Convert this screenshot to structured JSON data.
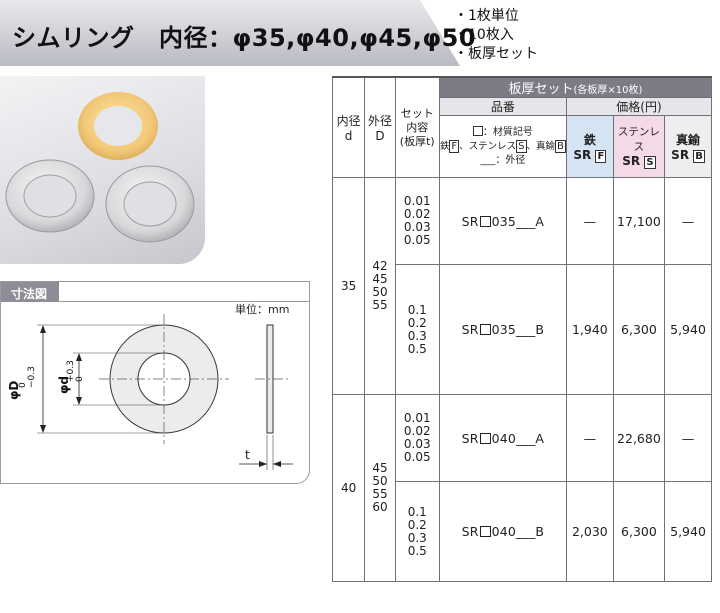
{
  "header": {
    "title": "シムリング　内径：φ35,φ40,φ45,φ50",
    "features": [
      "1枚単位",
      "10枚入",
      "板厚セット"
    ],
    "bullet": "・"
  },
  "dimension": {
    "tab_label": "寸法図",
    "unit_label": "単位：mm",
    "outer_label": "φD",
    "outer_tol_upper": "0",
    "outer_tol_lower": "−0.3",
    "inner_label": "φd",
    "inner_tol_upper": "+0.3",
    "inner_tol_lower": "0",
    "thickness_label": "t"
  },
  "table": {
    "headers": {
      "inner": "内径",
      "inner_sym": "d",
      "outer": "外径",
      "outer_sym": "D",
      "set": "セット",
      "set_contents": "内容",
      "set_thickness": "(板厚t)",
      "title": "板厚セット",
      "title_note": "(各板厚×10枚)",
      "part_number": "品番",
      "price": "価格(円)",
      "mat_key_1": "：材質記号",
      "mat_key_fe": "鉄",
      "mat_key_fe_code": "F",
      "mat_key_sus": "ステンレス",
      "mat_key_sus_code": "S",
      "mat_key_bs": "真鍮",
      "mat_key_bs_code": "B",
      "mat_key_2": "___：外径",
      "col_fe": "鉄",
      "col_sus": "ステンレス",
      "col_bs": "真鍮",
      "col_prefix": "SR",
      "col_fe_code": "F",
      "col_sus_code": "S",
      "col_bs_code": "B"
    },
    "groups": [
      {
        "inner": "35",
        "outers": [
          "42",
          "45",
          "50",
          "55"
        ],
        "rows": [
          {
            "thickness": [
              "0.01",
              "0.02",
              "0.03",
              "0.05"
            ],
            "pn_prefix": "SR",
            "pn_suffix": "035___A",
            "fe": "—",
            "sus": "17,100",
            "bs": "—"
          },
          {
            "thickness": [
              "0.1",
              "0.2",
              "0.3",
              "0.5"
            ],
            "pn_prefix": "SR",
            "pn_suffix": "035___B",
            "fe": "1,940",
            "sus": "6,300",
            "bs": "5,940"
          }
        ]
      },
      {
        "inner": "40",
        "outers": [
          "45",
          "50",
          "55",
          "60"
        ],
        "rows": [
          {
            "thickness": [
              "0.01",
              "0.02",
              "0.03",
              "0.05"
            ],
            "pn_prefix": "SR",
            "pn_suffix": "040___A",
            "fe": "—",
            "sus": "22,680",
            "bs": "—"
          },
          {
            "thickness": [
              "0.1",
              "0.2",
              "0.3",
              "0.5"
            ],
            "pn_prefix": "SR",
            "pn_suffix": "040___B",
            "fe": "2,030",
            "sus": "6,300",
            "bs": "5,940"
          }
        ]
      }
    ]
  },
  "colors": {
    "header_dark": "#7b7c86",
    "fe_column": "#d5e4f2",
    "sus_column": "#f4d9e6",
    "brass_ring": "#f2c87a"
  }
}
